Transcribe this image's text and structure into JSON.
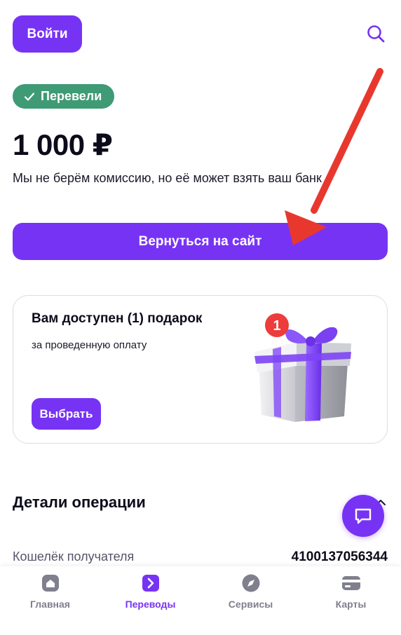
{
  "header": {
    "login_label": "Войти",
    "search_icon": "search-icon"
  },
  "status": {
    "label": "Перевели",
    "icon": "check-icon",
    "color": "#3f9a76"
  },
  "payment": {
    "amount": "1 000 ₽",
    "fee_note": "Мы не берём комиссию, но её может взять ваш банк"
  },
  "actions": {
    "return_label": "Вернуться на сайт"
  },
  "gift": {
    "title": "Вам доступен (1) подарок",
    "subtitle": "за проведенную оплату",
    "choose_label": "Выбрать",
    "badge_count": "1",
    "icon": "gift-box-icon"
  },
  "details": {
    "title": "Детали операции",
    "rows": [
      {
        "label": "Кошелёк получателя",
        "value": "4100137056344"
      }
    ]
  },
  "chat": {
    "icon": "chat-bubble-icon"
  },
  "bottom_nav": {
    "items": [
      {
        "label": "Главная",
        "icon": "home-icon",
        "active": false
      },
      {
        "label": "Переводы",
        "icon": "transfer-arrow-icon",
        "active": true
      },
      {
        "label": "Сервисы",
        "icon": "compass-icon",
        "active": false
      },
      {
        "label": "Карты",
        "icon": "card-icon",
        "active": false
      }
    ]
  },
  "colors": {
    "accent": "#7733f4",
    "success": "#3f9a76",
    "annotation_arrow": "#e8382e"
  }
}
